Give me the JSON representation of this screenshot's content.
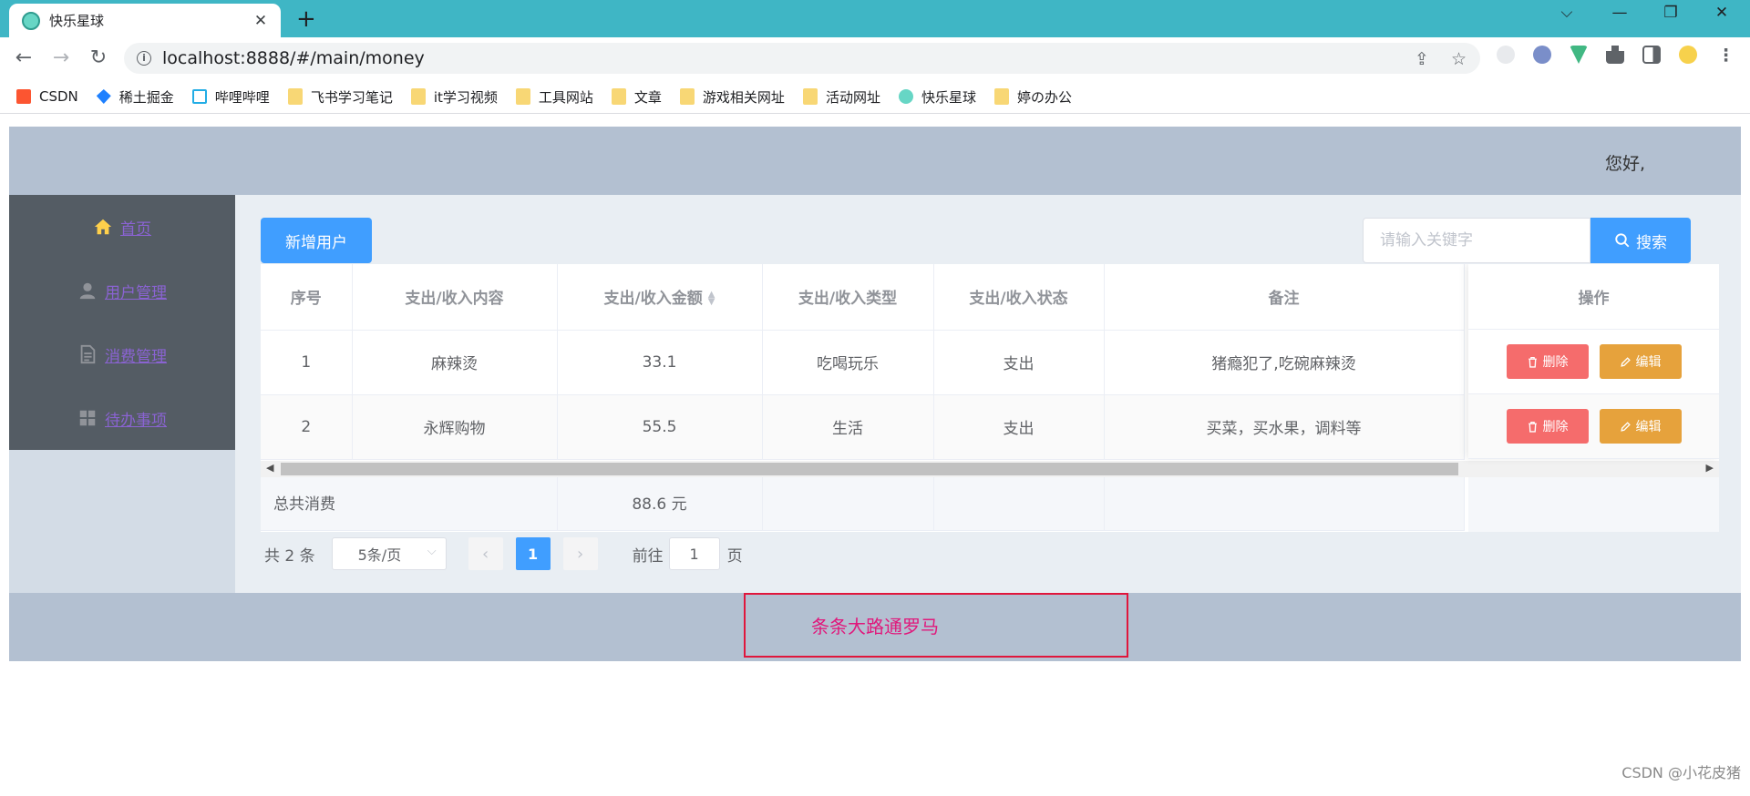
{
  "browser": {
    "tab_title": "快乐星球",
    "tab_close": "✕",
    "new_tab": "+",
    "url": "localhost:8888/#/main/money",
    "window_controls": {
      "dropdown": "⌵",
      "minimize": "—",
      "restore": "❐",
      "close": "✕"
    }
  },
  "bookmarks": [
    {
      "label": "CSDN",
      "icon": "csdn-icon"
    },
    {
      "label": "稀土掘金",
      "icon": "juejin-icon"
    },
    {
      "label": "哔哩哔哩",
      "icon": "bilibili-icon"
    },
    {
      "label": "飞书学习笔记",
      "icon": "folder-icon"
    },
    {
      "label": "it学习视频",
      "icon": "folder-icon"
    },
    {
      "label": "工具网站",
      "icon": "folder-icon"
    },
    {
      "label": "文章",
      "icon": "folder-icon"
    },
    {
      "label": "游戏相关网址",
      "icon": "folder-icon"
    },
    {
      "label": "活动网址",
      "icon": "folder-icon"
    },
    {
      "label": "快乐星球",
      "icon": "globe-icon"
    },
    {
      "label": "婷の办公",
      "icon": "folder-icon"
    }
  ],
  "header": {
    "greeting": "您好,"
  },
  "sidebar": {
    "items": [
      {
        "label": "首页",
        "icon": "home-icon"
      },
      {
        "label": "用户管理",
        "icon": "user-icon"
      },
      {
        "label": "消费管理",
        "icon": "document-icon"
      },
      {
        "label": "待办事项",
        "icon": "grid-icon"
      }
    ]
  },
  "main": {
    "add_button": "新增用户",
    "search": {
      "placeholder": "请输入关键字",
      "button": "搜索"
    }
  },
  "table": {
    "columns": [
      "序号",
      "支出/收入内容",
      "支出/收入金额",
      "支出/收入类型",
      "支出/收入状态",
      "备注",
      "操作"
    ],
    "rows": [
      {
        "index": "1",
        "content": "麻辣烫",
        "amount": "33.1",
        "type": "吃喝玩乐",
        "status": "支出",
        "note": "猪瘾犯了,吃碗麻辣烫"
      },
      {
        "index": "2",
        "content": "永辉购物",
        "amount": "55.5",
        "type": "生活",
        "status": "支出",
        "note": "买菜，买水果，调料等"
      }
    ],
    "delete_label": "删除",
    "edit_label": "编辑",
    "summary": {
      "label": "总共消费",
      "total": "88.6 元"
    }
  },
  "pagination": {
    "total": "共 2 条",
    "page_size": "5条/页",
    "current_page": "1",
    "goto_label": "前往",
    "goto_value": "1",
    "page_suffix": "页"
  },
  "footer": {
    "slogan": "条条大路通罗马"
  },
  "watermark": "CSDN @小花皮猪",
  "colors": {
    "primary": "#409eff",
    "danger": "#f56c6c",
    "warning": "#e6a23c",
    "header_bg": "#b3c0d1",
    "menu_bg": "#545c64",
    "tabbar": "#3fb6c5"
  }
}
